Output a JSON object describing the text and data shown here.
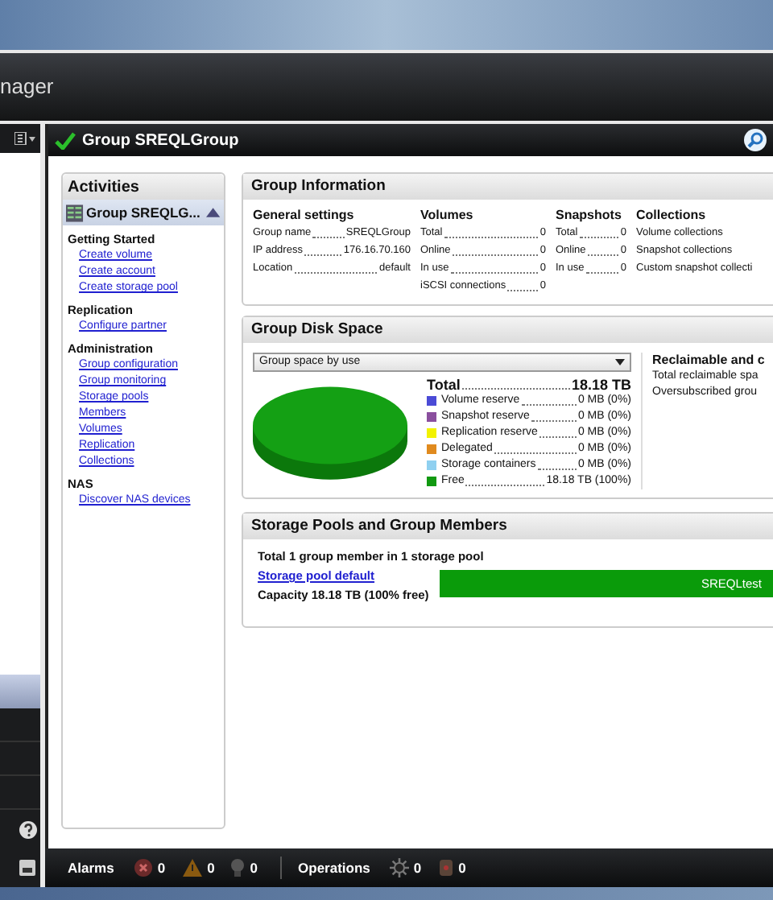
{
  "app_header": {
    "title": "nager"
  },
  "navigation_tabs": [
    {
      "selected": true
    },
    {
      "selected": false
    },
    {
      "selected": false
    },
    {
      "selected": false
    }
  ],
  "group_panel": {
    "title": "Group SREQLGroup"
  },
  "activities": {
    "title": "Activities",
    "group": {
      "label": "Group SREQLG...",
      "expanded": true
    },
    "sections": [
      {
        "heading": "Getting Started",
        "links": [
          "Create volume",
          "Create account",
          "Create storage pool"
        ]
      },
      {
        "heading": "Replication",
        "links": [
          "Configure partner"
        ]
      },
      {
        "heading": "Administration",
        "links": [
          "Group configuration",
          "Group monitoring",
          "Storage pools",
          "Members",
          "Volumes",
          "Replication",
          "Collections"
        ]
      },
      {
        "heading": "NAS",
        "links": [
          "Discover NAS devices"
        ]
      }
    ]
  },
  "group_information": {
    "title": "Group Information",
    "columns": [
      {
        "heading": "General settings",
        "rows": [
          {
            "label": "Group name",
            "value": "SREQLGroup"
          },
          {
            "label": "IP address",
            "value": "176.16.70.160"
          },
          {
            "label": "Location",
            "value": "default"
          }
        ]
      },
      {
        "heading": "Volumes",
        "rows": [
          {
            "label": "Total",
            "value": "0"
          },
          {
            "label": "Online",
            "value": "0"
          },
          {
            "label": "In use",
            "value": "0"
          },
          {
            "label": "iSCSI connections",
            "value": "0"
          }
        ]
      },
      {
        "heading": "Snapshots",
        "rows": [
          {
            "label": "Total",
            "value": "0"
          },
          {
            "label": "Online",
            "value": "0"
          },
          {
            "label": "In use",
            "value": "0"
          }
        ]
      },
      {
        "heading": "Collections",
        "rows": [
          {
            "label": "Volume collections",
            "value": ""
          },
          {
            "label": "Snapshot collections",
            "value": ""
          },
          {
            "label": "Custom snapshot collecti",
            "value": ""
          }
        ]
      }
    ]
  },
  "group_disk_space": {
    "title": "Group Disk Space",
    "dropdown": "Group space by use",
    "total_label": "Total",
    "total_value": "18.18 TB",
    "legend": [
      {
        "label": "Volume reserve",
        "value": "0 MB (0%)",
        "color": "#4b4bd6"
      },
      {
        "label": "Snapshot reserve",
        "value": "0 MB (0%)",
        "color": "#8a4f9e"
      },
      {
        "label": "Replication reserve",
        "value": "0 MB (0%)",
        "color": "#f2f200"
      },
      {
        "label": "Delegated",
        "value": "0 MB (0%)",
        "color": "#e08a1e"
      },
      {
        "label": "Storage containers",
        "value": "0 MB (0%)",
        "color": "#8fd0f0"
      },
      {
        "label": "Free",
        "value": "18.18 TB (100%)",
        "color": "#119911"
      }
    ],
    "reclaimable": {
      "heading": "Reclaimable and c",
      "lines": [
        "Total reclaimable spa",
        "Oversubscribed grou"
      ]
    }
  },
  "storage_pools": {
    "title": "Storage Pools and Group Members",
    "summary": "Total 1 group member in 1 storage pool",
    "pool_link": "Storage pool default",
    "capacity": "Capacity 18.18 TB (100% free)",
    "member": "SREQLtest"
  },
  "status_bar": {
    "alarms_label": "Alarms",
    "alarm_counts": [
      {
        "kind": "error",
        "count": "0"
      },
      {
        "kind": "warning",
        "count": "0"
      },
      {
        "kind": "info",
        "count": "0"
      }
    ],
    "operations_label": "Operations",
    "operation_counts": [
      {
        "kind": "running",
        "count": "0"
      },
      {
        "kind": "stopped",
        "count": "0"
      }
    ]
  }
}
